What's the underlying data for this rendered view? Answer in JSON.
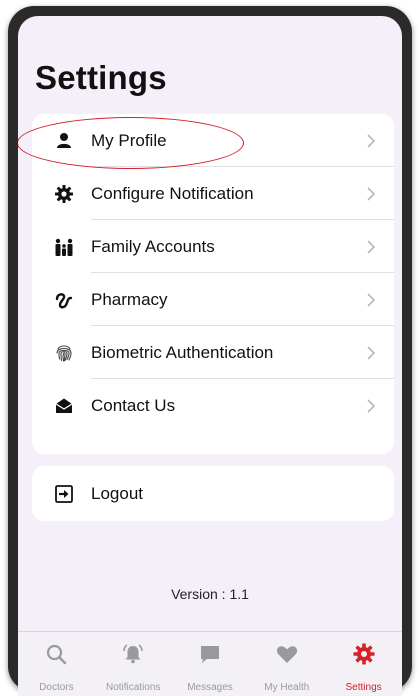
{
  "page": {
    "title": "Settings"
  },
  "menu": {
    "items": [
      {
        "label": "My Profile",
        "icon": "person-icon"
      },
      {
        "label": "Configure Notification",
        "icon": "gear-icon"
      },
      {
        "label": "Family Accounts",
        "icon": "family-icon"
      },
      {
        "label": "Pharmacy",
        "icon": "pharmacy-icon"
      },
      {
        "label": "Biometric Authentication",
        "icon": "fingerprint-icon"
      },
      {
        "label": "Contact Us",
        "icon": "envelope-open-icon"
      }
    ]
  },
  "logout": {
    "label": "Logout",
    "icon": "logout-icon"
  },
  "footer": {
    "version": "Version : 1.1"
  },
  "tabbar": {
    "tabs": [
      {
        "label": "Doctors",
        "icon": "search-icon",
        "active": false
      },
      {
        "label": "Notifications",
        "icon": "bell-icon",
        "active": false
      },
      {
        "label": "Messages",
        "icon": "chat-icon",
        "active": false
      },
      {
        "label": "My Health",
        "icon": "heart-icon",
        "active": false
      },
      {
        "label": "Settings",
        "icon": "gear-icon",
        "active": true
      }
    ]
  },
  "colors": {
    "accent": "#d6202a",
    "background": "#f4eff8",
    "card": "#ffffff",
    "inactive_tab": "#9a9a9a"
  }
}
